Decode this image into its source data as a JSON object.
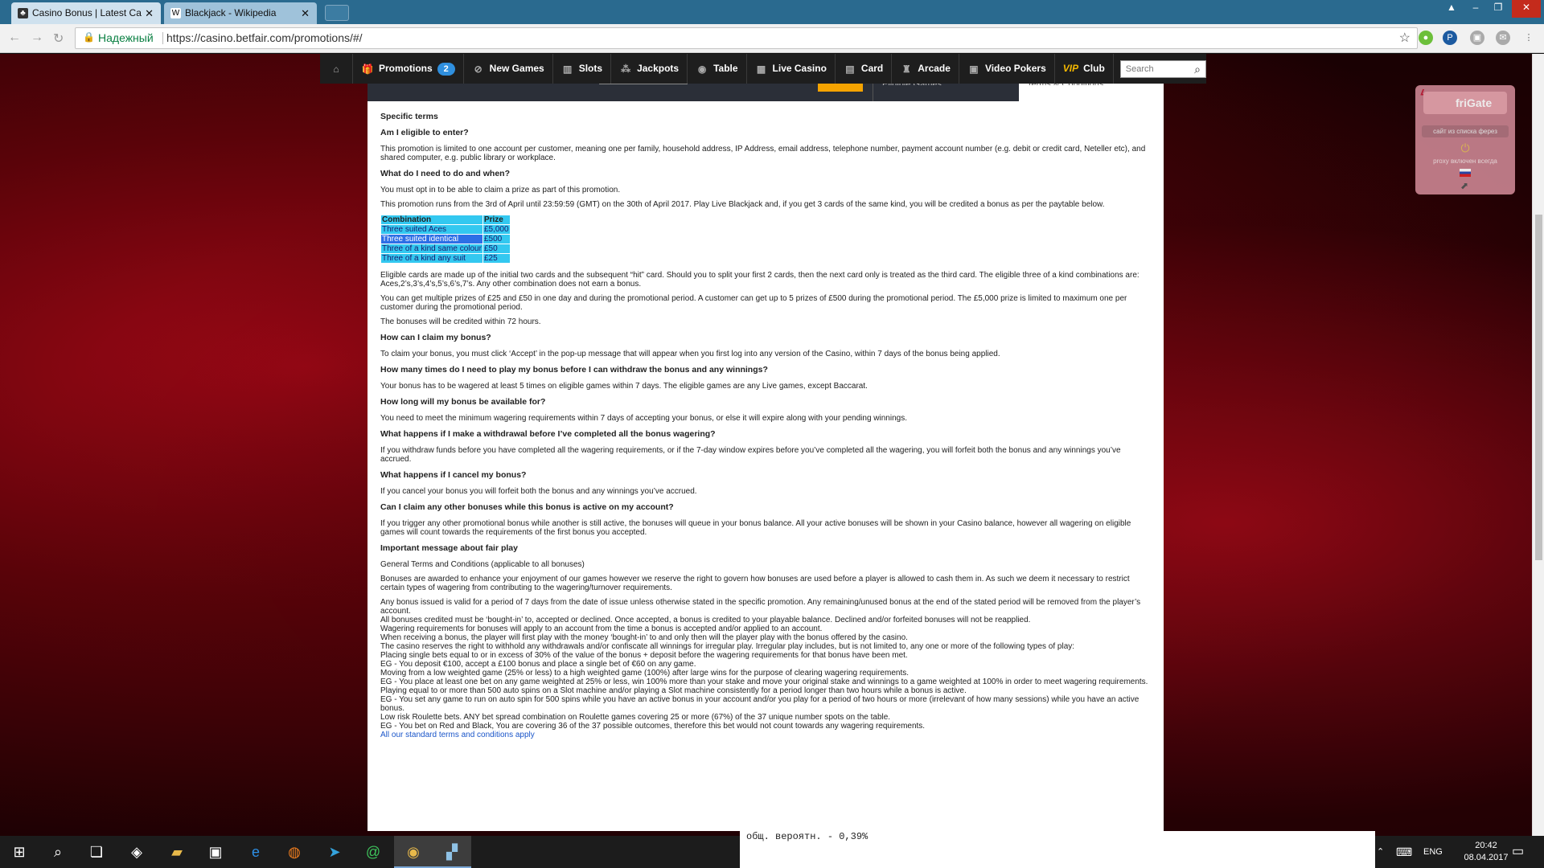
{
  "browser": {
    "tabs": [
      {
        "title": "Casino Bonus | Latest Ca",
        "favicon": "casino-favicon",
        "active": true
      },
      {
        "title": "Blackjack - Wikipedia",
        "favicon": "W",
        "active": false
      }
    ],
    "address": {
      "secure_label": "Надежный",
      "url": "https://casino.betfair.com/promotions/#/"
    },
    "extensions": [
      "green-ext-icon",
      "p-ext-icon",
      "user-ext-icon",
      "mail-ext-icon"
    ]
  },
  "nav": {
    "items": [
      {
        "label": "Promotions",
        "icon": "gift-icon",
        "badge": "2"
      },
      {
        "label": "New Games",
        "icon": "new-games-icon"
      },
      {
        "label": "Slots",
        "icon": "slots-icon"
      },
      {
        "label": "Jackpots",
        "icon": "jackpots-icon"
      },
      {
        "label": "Table",
        "icon": "table-icon"
      },
      {
        "label": "Live Casino",
        "icon": "live-casino-icon"
      },
      {
        "label": "Card",
        "icon": "card-icon"
      },
      {
        "label": "Arcade",
        "icon": "arcade-icon"
      },
      {
        "label": "Video Pokers",
        "icon": "video-poker-icon"
      },
      {
        "label": "Club",
        "icon": "vip-icon",
        "prefix": "VIP"
      }
    ],
    "search_placeholder": "Search"
  },
  "strip": {
    "eligible": "Eligible Games",
    "terms": "Terms & Conditions"
  },
  "terms": {
    "heading": "Specific terms",
    "q1": "Am I eligible to enter?",
    "a1": "This promotion is limited to one account per customer, meaning one per family, household address, IP Address, email address, telephone number, payment account number (e.g. debit or credit card, Neteller etc), and shared computer, e.g. public library or workplace.",
    "q2": "What do I need to do and when?",
    "a2a": "You must opt in to be able to claim a prize as part of this promotion.",
    "a2b": "This promotion runs from the 3rd of April until 23:59:59 (GMT) on the 30th of April 2017. Play Live Blackjack and, if you get 3 cards of the same kind, you will be credited a bonus as per the paytable below.",
    "paytable": {
      "headers": [
        "Combination",
        "Prize"
      ],
      "rows": [
        [
          "Three suited Aces",
          "£5,000"
        ],
        [
          "Three suited identical",
          "£500"
        ],
        [
          "Three of a kind same colour",
          "£50"
        ],
        [
          "Three of a kind any suit",
          "£25"
        ]
      ]
    },
    "a2c": "Eligible cards are made up of the initial two cards and the subsequent “hit” card. Should you to split your first 2 cards, then the next card only is treated as the third card. The eligible three of a kind combinations are: Aces,2’s,3’s,4’s,5’s,6’s,7’s. Any other combination does not earn a bonus.",
    "a2d": "You can get multiple prizes of £25 and £50 in one day and during the promotional period. A customer can get up to 5 prizes of £500 during the promotional period. The £5,000 prize is limited to maximum one per customer during the promotional period.",
    "a2e": "The bonuses will be credited within 72 hours.",
    "q3": "How can I claim my bonus?",
    "a3": "To claim your bonus, you must click ‘Accept’ in the pop-up message that will appear when you first log into any version of the Casino, within 7 days of the bonus being applied.",
    "q4": "How many times do I need to play my bonus before I can withdraw the bonus and any winnings?",
    "a4": "Your bonus has to be wagered at least 5 times on eligible games within 7 days. The eligible games are any Live games, except Baccarat.",
    "q5": "How long will my bonus be available for?",
    "a5": "You need to meet the minimum wagering requirements within 7 days of accepting your bonus, or else it will expire along with your pending winnings.",
    "q6": "What happens if I make a withdrawal before I’ve completed all the bonus wagering?",
    "a6": "If you withdraw funds before you have completed all the wagering requirements, or if the 7-day window expires before you’ve completed all the wagering, you will forfeit both the bonus and any winnings you’ve accrued.",
    "q7": "What happens if I cancel my bonus?",
    "a7": "If you cancel your bonus you will forfeit both the bonus and any winnings you’ve accrued.",
    "q8": "Can I claim any other bonuses while this bonus is active on my account?",
    "a8": "If you trigger any other promotional bonus while another is still active, the bonuses will queue in your bonus balance. All your active bonuses will be shown in your Casino balance, however all wagering on eligible games will count towards the requirements of the first bonus you accepted.",
    "q9": "Important message about fair play",
    "general": "General Terms and Conditions (applicable to all bonuses)",
    "g1": "Bonuses are awarded to enhance your enjoyment of our games however we reserve the right to govern how bonuses are used before a player is allowed to cash them in. As such we deem it necessary to restrict certain types of wagering from contributing to the wagering/turnover requirements.",
    "g_lines": [
      "Any bonus issued is valid for a period of 7 days from the date of issue unless otherwise stated in the specific promotion. Any remaining/unused bonus at the end of the stated period will be removed from the player’s account.",
      "All bonuses credited must be ‘bought-in’ to, accepted or declined. Once accepted, a bonus is credited to your playable balance. Declined and/or forfeited bonuses will not be reapplied.",
      "Wagering requirements for bonuses will apply to an account from the time a bonus is accepted and/or applied to an account.",
      "When receiving a bonus, the player will first play with the money ‘bought-in’ to and only then will the player play with the bonus offered by the casino.",
      "The casino reserves the right to withhold any withdrawals and/or confiscate all winnings for irregular play. Irregular play includes, but is not limited to, any one or more of the following types of play:",
      "Placing single bets equal to or in excess of 30% of the value of the bonus + deposit before the wagering requirements for that bonus have been met.",
      "EG - You deposit €100, accept a £100 bonus and place a single bet of €60 on any game.",
      "Moving from a low weighted game (25% or less) to a high weighted game (100%) after large wins for the purpose of clearing wagering requirements.",
      "EG - You place at least one bet on any game weighted at 25% or less, win 100% more than your stake and move your original stake and winnings to a game weighted at 100% in order to meet wagering requirements.",
      "Playing equal to or more than 500 auto spins on a Slot machine and/or playing a Slot machine consistently for a period longer than two hours while a bonus is active.",
      "EG - You set any game to run on auto spin for 500 spins while you have an active bonus in your account and/or you play for a period of two hours or more (irrelevant of how many sessions) while you have an active bonus.",
      "Low risk Roulette bets. ANY bet spread combination on Roulette games covering 25 or more (67%) of the 37 unique number spots on the table.",
      "EG - You bet on Red and Black, You are covering 36 of the 37 possible outcomes, therefore this bet would not count towards any wagering requirements."
    ],
    "link": "All our standard terms and conditions apply"
  },
  "frigate": {
    "title": "friGate",
    "site_chip": "сайт из списка ферез",
    "proxy_note": "proxy включен всегда"
  },
  "console": {
    "line": "общ. вероятн. - 0,39%"
  },
  "taskbar": {
    "lang": "ENG",
    "time": "20:42",
    "date": "08.04.2017"
  }
}
